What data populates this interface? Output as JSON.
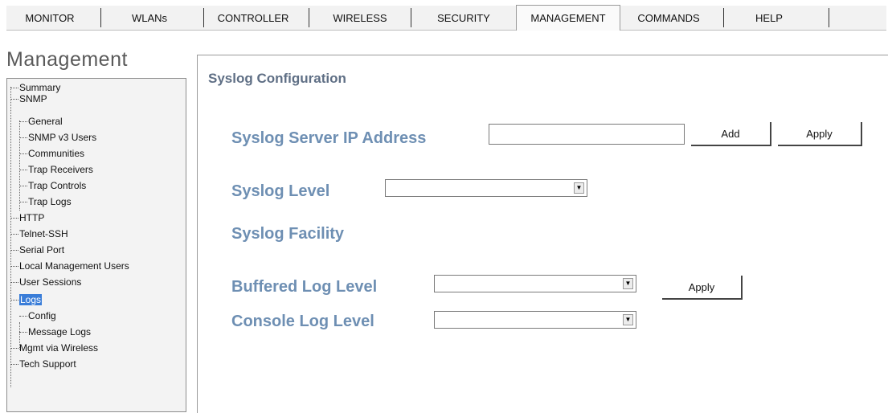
{
  "tabs": {
    "monitor": "MONITOR",
    "wlans": "WLANs",
    "controller": "CONTROLLER",
    "wireless": "WIRELESS",
    "security": "SECURITY",
    "management": "MANAGEMENT",
    "commands": "COMMANDS",
    "help": "HELP",
    "active": "MANAGEMENT"
  },
  "sidebar": {
    "title": "Management",
    "items": {
      "summary": "Summary",
      "snmp": "SNMP",
      "general": "General",
      "snmp_v3_users": "SNMP v3 Users",
      "communities": "Communities",
      "trap_receivers": "Trap Receivers",
      "trap_controls": "Trap Controls",
      "trap_logs": "Trap Logs",
      "http": "HTTP",
      "telnet_ssh": "Telnet-SSH",
      "serial_port": "Serial Port",
      "local_management_users": "Local Management Users",
      "user_sessions": "User Sessions",
      "logs": "Logs",
      "config": "Config",
      "message_logs": "Message Logs",
      "mgmt_via_wireless": "Mgmt via Wireless",
      "tech_support": "Tech Support"
    },
    "selected": "Logs"
  },
  "main": {
    "title": "Syslog Configuration",
    "syslog_server_ip": {
      "label": "Syslog Server IP Address",
      "value": "",
      "add_label": "Add",
      "apply_label": "Apply"
    },
    "syslog_level": {
      "label": "Syslog Level",
      "value": ""
    },
    "syslog_facility": {
      "label": "Syslog Facility"
    },
    "buffered_log_level": {
      "label": "Buffered Log Level",
      "value": "",
      "apply_label": "Apply"
    },
    "console_log_level": {
      "label": "Console Log Level",
      "value": ""
    }
  },
  "colors": {
    "label_blue": "#6e8fb3",
    "title_gray": "#5f6f85",
    "selection": "#3a7dd8"
  }
}
